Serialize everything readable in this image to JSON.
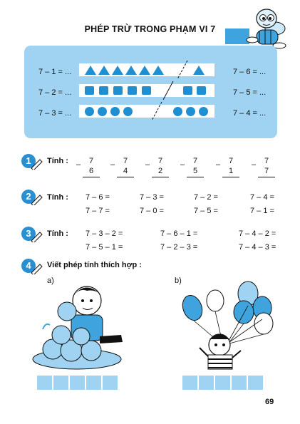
{
  "header": {
    "title": "PHÉP TRỪ TRONG PHẠM VI 7"
  },
  "panel": {
    "rows": [
      {
        "left": "7 – 1 = ...",
        "right": "7 – 6 = ..."
      },
      {
        "left": "7 – 2 = ...",
        "right": "7 – 5 = ..."
      },
      {
        "left": "7 – 3 = ...",
        "right": "7 – 4 = ..."
      }
    ],
    "shape_rows": [
      {
        "shape": "triangle",
        "count": 7
      },
      {
        "shape": "square",
        "count": 7
      },
      {
        "shape": "circle",
        "count": 7
      }
    ],
    "shape_color": "#1f8fd2"
  },
  "ex1": {
    "number": "1",
    "label": "Tính :",
    "items": [
      {
        "top": "7",
        "bottom": "6"
      },
      {
        "top": "7",
        "bottom": "4"
      },
      {
        "top": "7",
        "bottom": "2"
      },
      {
        "top": "7",
        "bottom": "5"
      },
      {
        "top": "7",
        "bottom": "1"
      },
      {
        "top": "7",
        "bottom": "7"
      }
    ]
  },
  "ex2": {
    "number": "2",
    "label": "Tính :",
    "cols": [
      [
        "7 – 6 =",
        "7 – 7 ="
      ],
      [
        "7 – 3 =",
        "7 – 0 ="
      ],
      [
        "7 – 2 =",
        "7 – 5 ="
      ],
      [
        "7 – 4 =",
        "7 – 1 ="
      ]
    ]
  },
  "ex3": {
    "number": "3",
    "label": "Tính :",
    "cols": [
      [
        "7 – 3 – 2 =",
        "7 – 5 – 1 ="
      ],
      [
        "7 – 6 – 1 =",
        "7 – 2 – 3 ="
      ],
      [
        "7 – 4 – 2 =",
        "7 – 4 – 3 ="
      ]
    ]
  },
  "ex4": {
    "number": "4",
    "label": "Viết phép tính thích hợp :",
    "part_a": "a)",
    "part_b": "b)"
  },
  "page_number": "69",
  "colors": {
    "accent": "#3fa4dd",
    "panel": "#9fd3f1",
    "badge": "#2a8fd0"
  }
}
